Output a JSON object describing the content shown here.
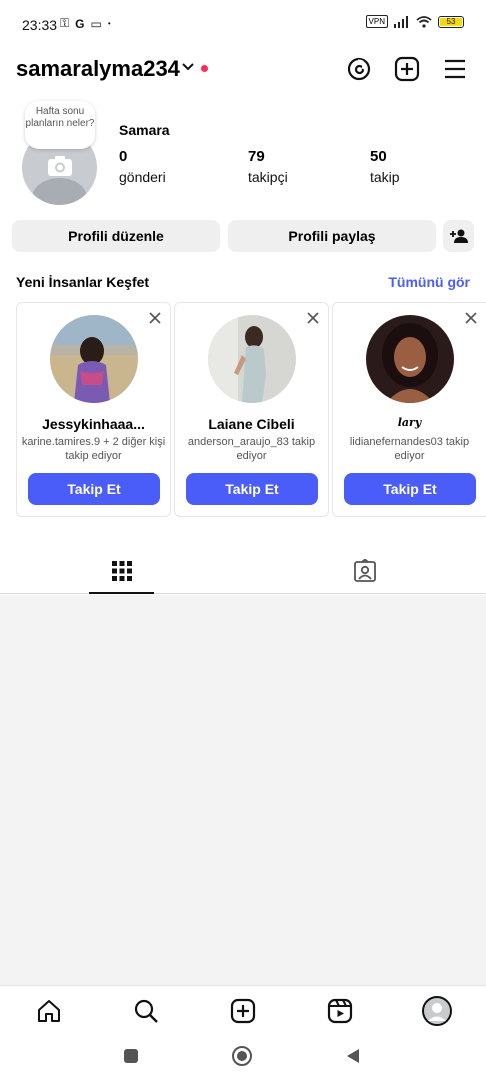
{
  "status_bar": {
    "time": "23:33",
    "left_icons": [
      "key-icon",
      "google-icon",
      "screen-icon",
      "dot"
    ],
    "vpn": "VPN",
    "battery": "53"
  },
  "header": {
    "username": "samaralyma234",
    "icons": [
      "threads-icon",
      "add-icon",
      "menu-icon"
    ]
  },
  "profile": {
    "note": "Hafta sonu planların neler?",
    "display_name": "Samara",
    "stats": [
      {
        "value": "0",
        "label": "gönderi"
      },
      {
        "value": "79",
        "label": "takipçi"
      },
      {
        "value": "50",
        "label": "takip"
      }
    ],
    "edit_label": "Profili düzenle",
    "share_label": "Profili paylaş"
  },
  "discover": {
    "title": "Yeni İnsanlar Keşfet",
    "see_all": "Tümünü gör",
    "follow_label": "Takip Et",
    "cards": [
      {
        "name": "Jessykinhaaa...",
        "sub": "karine.tamires.9 + 2 diğer kişi takip ediyor"
      },
      {
        "name": "Laiane Cibeli",
        "sub": "anderson_araujo_83 takip ediyor"
      },
      {
        "name": "lary",
        "sub": "lidianefernandes03 takip ediyor"
      }
    ]
  },
  "tabs": [
    "grid-icon",
    "tagged-icon"
  ],
  "bottom_nav": [
    "home-icon",
    "search-icon",
    "create-icon",
    "reels-icon",
    "profile-icon"
  ],
  "colors": {
    "accent": "#4a5df9",
    "dot": "#ff2d55"
  }
}
